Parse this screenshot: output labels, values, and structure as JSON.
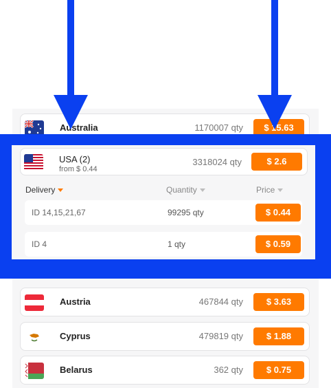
{
  "rows": [
    {
      "country": "Australia",
      "qty": "1170007 qty",
      "price": "$ 15.63"
    },
    {
      "country": "Austria",
      "qty": "467844 qty",
      "price": "$ 3.63"
    },
    {
      "country": "Cyprus",
      "qty": "479819 qty",
      "price": "$ 1.88"
    },
    {
      "country": "Belarus",
      "qty": "362 qty",
      "price": "$ 0.75"
    }
  ],
  "usa": {
    "country": "USA (2)",
    "from": "from $ 0.44",
    "qty": "3318024 qty",
    "price": "$ 2.6",
    "columns": {
      "delivery": "Delivery",
      "quantity": "Quantity",
      "price": "Price"
    },
    "options": [
      {
        "id": "ID 14,15,21,67",
        "qty": "99295 qty",
        "price": "$ 0.44"
      },
      {
        "id": "ID 4",
        "qty": "1 qty",
        "price": "$ 0.59"
      }
    ]
  },
  "colors": {
    "accent": "#ff7a00",
    "highlight": "#0a40f0"
  },
  "icons": [
    "flag-australia-icon",
    "flag-usa-icon",
    "flag-austria-icon",
    "flag-cyprus-icon",
    "flag-belarus-icon",
    "arrow-down-icon"
  ]
}
